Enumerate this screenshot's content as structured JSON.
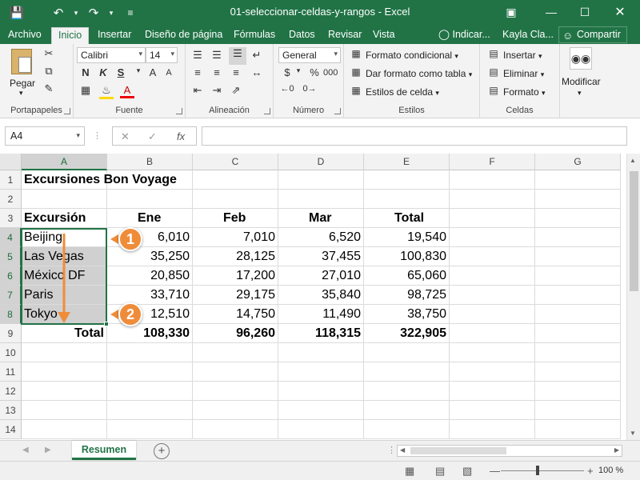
{
  "window": {
    "title": "01-seleccionar-celdas-y-rangos  -  Excel"
  },
  "tabs": [
    "Archivo",
    "Inicio",
    "Insertar",
    "Diseño de página",
    "Fórmulas",
    "Datos",
    "Revisar",
    "Vista"
  ],
  "active_tab": "Inicio",
  "tell_me": "Indicar...",
  "user": "Kayla Cla...",
  "share": "Compartir",
  "ribbon": {
    "clipboard": {
      "label": "Portapapeles",
      "paste": "Pegar"
    },
    "font": {
      "label": "Fuente",
      "name": "Calibri",
      "size": "14",
      "bold": "N",
      "italic": "K",
      "underline": "S"
    },
    "alignment": {
      "label": "Alineación"
    },
    "number": {
      "label": "Número",
      "format": "General",
      "currency": "$",
      "percent": "%",
      "comma": "000"
    },
    "styles": {
      "label": "Estilos",
      "cond_format": "Formato condicional",
      "table_format": "Dar formato como tabla",
      "cell_styles": "Estilos de celda"
    },
    "cells": {
      "label": "Celdas",
      "insert": "Insertar",
      "delete": "Eliminar",
      "format": "Formato"
    },
    "editing": {
      "label": "Modificar"
    }
  },
  "name_box": "A4",
  "formula": "",
  "columns": [
    "A",
    "B",
    "C",
    "D",
    "E",
    "F",
    "G"
  ],
  "rows": [
    {
      "num": "1",
      "cells": [
        "Excursiones Bon Voyage",
        "",
        "",
        "",
        "",
        "",
        ""
      ]
    },
    {
      "num": "2",
      "cells": [
        "",
        "",
        "",
        "",
        "",
        "",
        ""
      ]
    },
    {
      "num": "3",
      "cells": [
        "Excursión",
        "Ene",
        "Feb",
        "Mar",
        "Total",
        "",
        ""
      ]
    },
    {
      "num": "4",
      "cells": [
        "Beijing",
        "6,010",
        "7,010",
        "6,520",
        "19,540",
        "",
        ""
      ]
    },
    {
      "num": "5",
      "cells": [
        "Las Vegas",
        "35,250",
        "28,125",
        "37,455",
        "100,830",
        "",
        ""
      ]
    },
    {
      "num": "6",
      "cells": [
        "México DF",
        "20,850",
        "17,200",
        "27,010",
        "65,060",
        "",
        ""
      ]
    },
    {
      "num": "7",
      "cells": [
        "Paris",
        "33,710",
        "29,175",
        "35,840",
        "98,725",
        "",
        ""
      ]
    },
    {
      "num": "8",
      "cells": [
        "Tokyo",
        "12,510",
        "14,750",
        "11,490",
        "38,750",
        "",
        ""
      ]
    },
    {
      "num": "9",
      "cells": [
        "Total",
        "108,330",
        "96,260",
        "118,315",
        "322,905",
        "",
        ""
      ]
    },
    {
      "num": "10",
      "cells": [
        "",
        "",
        "",
        "",
        "",
        "",
        ""
      ]
    },
    {
      "num": "11",
      "cells": [
        "",
        "",
        "",
        "",
        "",
        "",
        ""
      ]
    },
    {
      "num": "12",
      "cells": [
        "",
        "",
        "",
        "",
        "",
        "",
        ""
      ]
    },
    {
      "num": "13",
      "cells": [
        "",
        "",
        "",
        "",
        "",
        "",
        ""
      ]
    },
    {
      "num": "14",
      "cells": [
        "",
        "",
        "",
        "",
        "",
        "",
        ""
      ]
    }
  ],
  "callouts": [
    "1",
    "2"
  ],
  "sheet_tab": "Resumen",
  "zoom": "100 %",
  "colors": {
    "accent": "#217346",
    "callout": "#ef8c3a"
  }
}
